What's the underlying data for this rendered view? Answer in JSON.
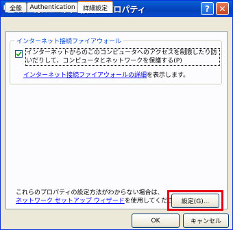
{
  "window": {
    "title": "ローカル エリア 接続のプロパティ",
    "help_glyph": "?",
    "close_glyph": "✕"
  },
  "tabs": [
    {
      "label": "全般",
      "active": false
    },
    {
      "label": "Authentication",
      "active": false
    },
    {
      "label": "詳細設定",
      "active": true
    }
  ],
  "firewall_group": {
    "title": "インターネット接続ファイアウォール",
    "checkbox_checked": true,
    "checkbox_label": "インターネットからのこのコンピュータへのアクセスを制限したり防いだりして、コンピュータとネットワークを保護する(P)",
    "learn_more_link": "インターネット接続ファイアウォールの詳細",
    "learn_more_suffix": "を表示します。"
  },
  "bottom": {
    "line1": "これらのプロパティの設定方法がわからない場合は、",
    "wizard_link": "ネットワーク セットアップ ウィザード",
    "line2_suffix": "を使用してください。",
    "settings_button": "設定(G)..."
  },
  "buttons": {
    "ok": "OK",
    "cancel": "キャンセル"
  },
  "colors": {
    "titlebar": "#0a5fd8",
    "dialog_bg": "#ece9d8",
    "highlight_box": "#e60012",
    "link": "#0000ff"
  }
}
